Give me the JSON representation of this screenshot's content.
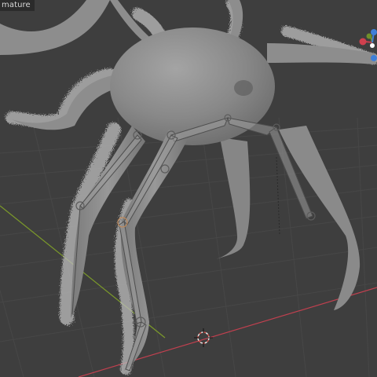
{
  "viewport": {
    "object_label": "mature",
    "background_color": "#3e3e3e",
    "grid_color": "#474747",
    "x_axis_color": "#c0404f",
    "y_axis_color": "#7c9a2a",
    "mesh_color": "#8c8c8c",
    "fur_color": "#bdbdbd",
    "bone_color": "#9a9a9a"
  },
  "gizmo": {
    "axes": [
      "x-axis-icon",
      "y-axis-icon",
      "z-axis-icon"
    ]
  },
  "scene": {
    "object": "spider-mesh",
    "armature": "leg-armature",
    "cursor": "3d-cursor-icon"
  }
}
